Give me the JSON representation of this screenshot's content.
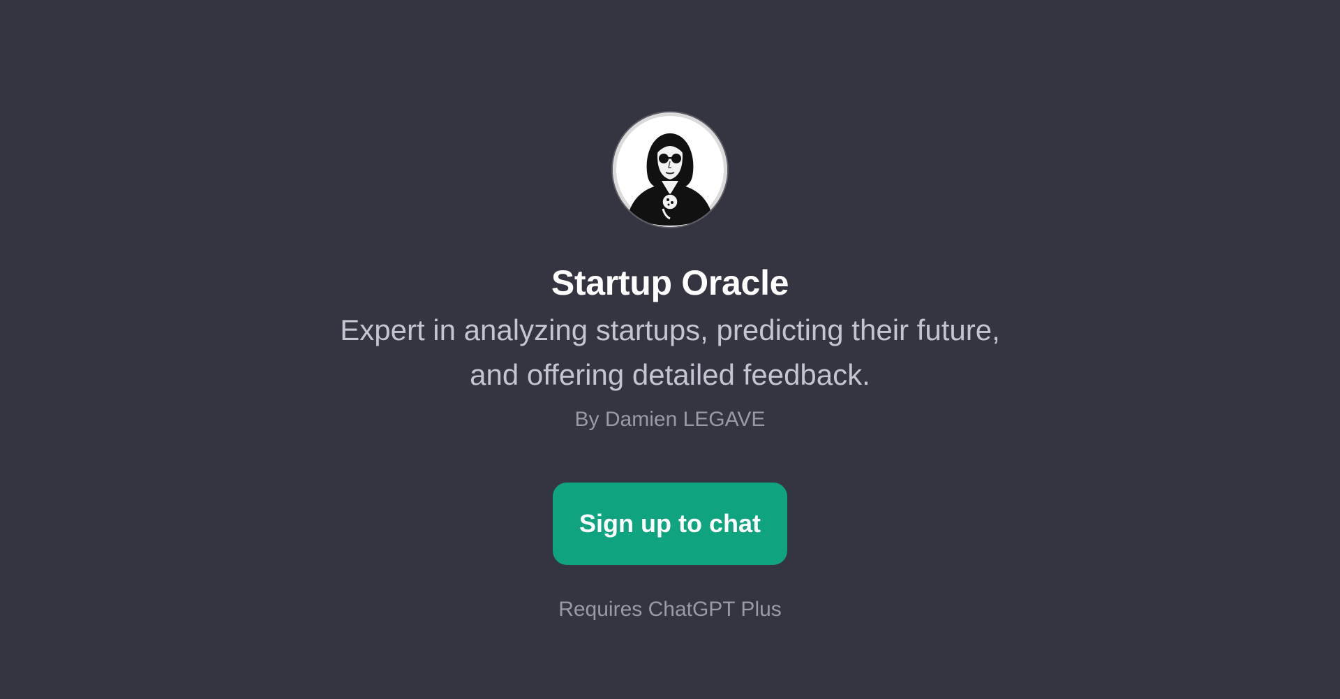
{
  "gpt": {
    "name": "Startup Oracle",
    "description": "Expert in analyzing startups, predicting their future, and offering detailed feedback.",
    "author": "By Damien LEGAVE",
    "avatar_icon": "oracle-portrait-icon"
  },
  "actions": {
    "signup_label": "Sign up to chat"
  },
  "footer": {
    "requirement": "Requires ChatGPT Plus"
  },
  "colors": {
    "background": "#343541",
    "accent": "#10a37f",
    "title": "#ffffff",
    "description": "#c5c5d2",
    "muted": "#9a9aa6"
  }
}
